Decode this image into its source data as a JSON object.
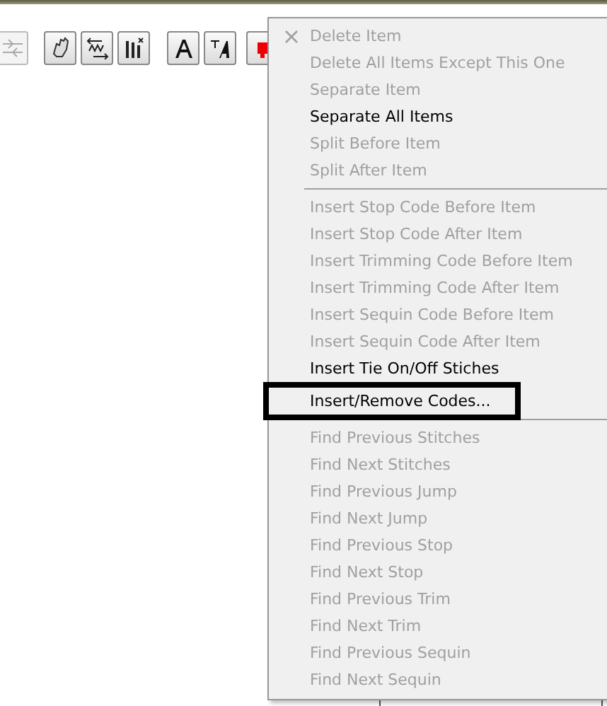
{
  "toolbar": {
    "buttons": [
      {
        "kind": "stitch",
        "disabled": true
      },
      {
        "kind": "hand",
        "disabled": false
      },
      {
        "kind": "zigzag",
        "disabled": false
      },
      {
        "kind": "columns",
        "disabled": false
      },
      {
        "kind": "letter",
        "disabled": false
      },
      {
        "kind": "textedit",
        "disabled": false
      },
      {
        "kind": "red",
        "disabled": false
      }
    ]
  },
  "context_menu": {
    "sections": [
      {
        "items": [
          {
            "label": "Delete Item",
            "disabled": true,
            "kind": "delete",
            "outlined": false
          },
          {
            "label": "Delete All Items Except This One",
            "disabled": true,
            "kind": "plain",
            "outlined": false
          },
          {
            "label": "Separate Item",
            "disabled": true,
            "kind": "plain",
            "outlined": false
          },
          {
            "label": "Separate All Items",
            "disabled": false,
            "kind": "plain",
            "outlined": false
          },
          {
            "label": "Split Before Item",
            "disabled": true,
            "kind": "plain",
            "outlined": false
          },
          {
            "label": "Split After Item",
            "disabled": true,
            "kind": "plain",
            "outlined": false
          }
        ]
      },
      {
        "items": [
          {
            "label": "Insert Stop Code Before Item",
            "disabled": true,
            "kind": "plain",
            "outlined": false
          },
          {
            "label": "Insert Stop Code After Item",
            "disabled": true,
            "kind": "plain",
            "outlined": false
          },
          {
            "label": "Insert Trimming Code Before Item",
            "disabled": true,
            "kind": "plain",
            "outlined": false
          },
          {
            "label": "Insert Trimming Code After Item",
            "disabled": true,
            "kind": "plain",
            "outlined": false
          },
          {
            "label": "Insert Sequin Code Before Item",
            "disabled": true,
            "kind": "plain",
            "outlined": false
          },
          {
            "label": "Insert Sequin Code After Item",
            "disabled": true,
            "kind": "plain",
            "outlined": false
          },
          {
            "label": "Insert Tie On/Off Stiches",
            "disabled": false,
            "kind": "plain",
            "outlined": false
          },
          {
            "label": "Insert/Remove Codes...",
            "disabled": false,
            "kind": "plain",
            "outlined": true
          }
        ]
      },
      {
        "items": [
          {
            "label": "Find Previous Stitches",
            "disabled": true,
            "kind": "plain",
            "outlined": false
          },
          {
            "label": "Find Next Stitches",
            "disabled": true,
            "kind": "plain",
            "outlined": false
          },
          {
            "label": "Find Previous Jump",
            "disabled": true,
            "kind": "plain",
            "outlined": false
          },
          {
            "label": "Find Next Jump",
            "disabled": true,
            "kind": "plain",
            "outlined": false
          },
          {
            "label": "Find Previous Stop",
            "disabled": true,
            "kind": "plain",
            "outlined": false
          },
          {
            "label": "Find Next Stop",
            "disabled": true,
            "kind": "plain",
            "outlined": false
          },
          {
            "label": "Find Previous Trim",
            "disabled": true,
            "kind": "plain",
            "outlined": false
          },
          {
            "label": "Find Next Trim",
            "disabled": true,
            "kind": "plain",
            "outlined": false
          },
          {
            "label": "Find Previous Sequin",
            "disabled": true,
            "kind": "plain",
            "outlined": false
          },
          {
            "label": "Find Next Sequin",
            "disabled": true,
            "kind": "plain",
            "outlined": false
          }
        ]
      }
    ]
  }
}
